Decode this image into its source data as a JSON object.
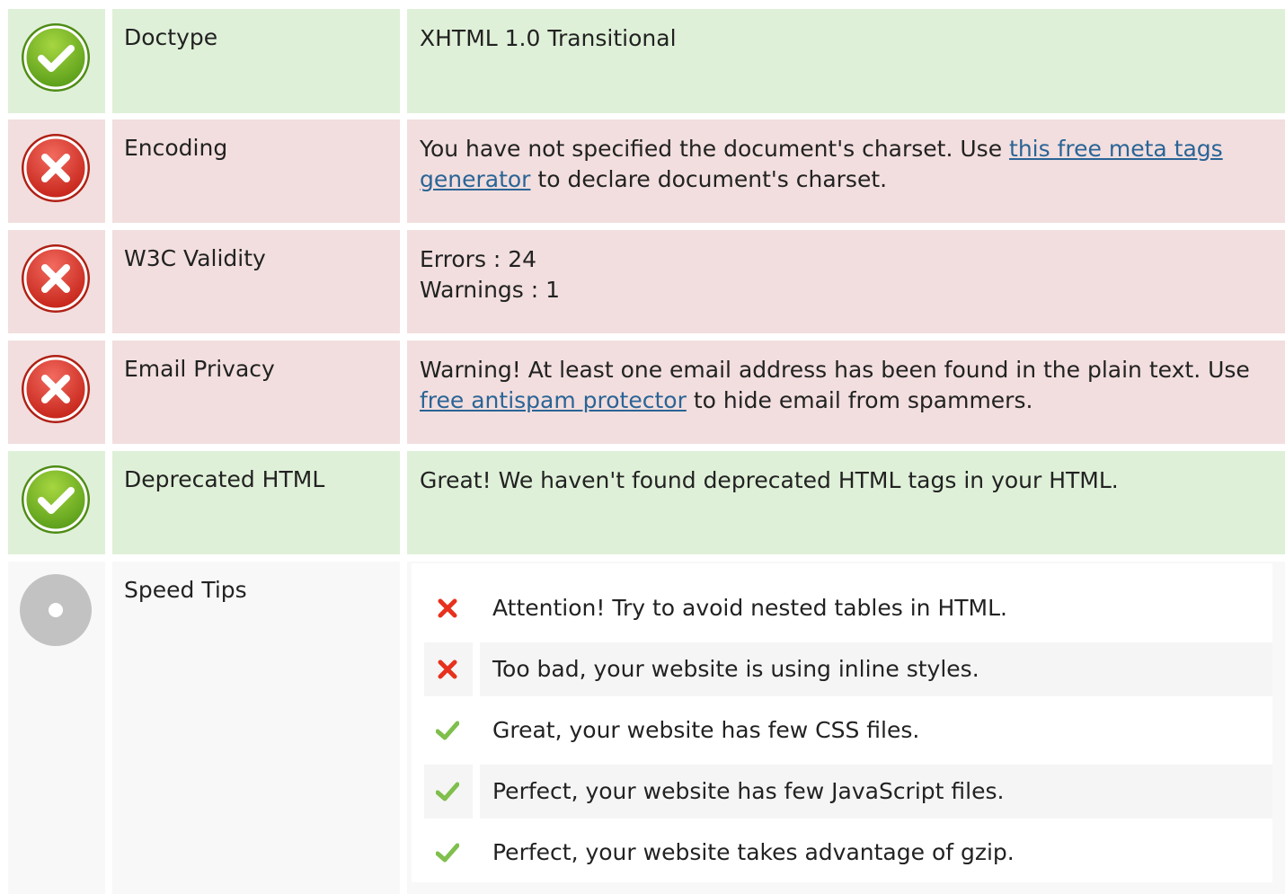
{
  "rows": [
    {
      "status": "ok",
      "label": "Doctype",
      "value": "XHTML 1.0 Transitional"
    },
    {
      "status": "error",
      "label": "Encoding",
      "value_before": "You have not specified the document's charset. Use ",
      "link_text": "this free meta tags generator",
      "value_after": " to declare document's charset."
    },
    {
      "status": "error",
      "label": "W3C Validity",
      "line1": "Errors : 24",
      "line2": "Warnings : 1"
    },
    {
      "status": "error",
      "label": "Email Privacy",
      "value_before": "Warning! At least one email address has been found in the plain text. Use ",
      "link_text": "free antispam protector",
      "value_after": " to hide email from spammers."
    },
    {
      "status": "ok",
      "label": "Deprecated HTML",
      "value": "Great! We haven't found deprecated HTML tags in your HTML."
    },
    {
      "status": "neutral",
      "label": "Speed Tips"
    }
  ],
  "speed_tips": [
    {
      "status": "fail",
      "icon": "cross-icon",
      "text": "Attention! Try to avoid nested tables in HTML."
    },
    {
      "status": "fail",
      "icon": "cross-icon",
      "text": "Too bad, your website is using inline styles."
    },
    {
      "status": "pass",
      "icon": "check-icon",
      "text": "Great, your website has few CSS files."
    },
    {
      "status": "pass",
      "icon": "check-icon",
      "text": "Perfect, your website has few JavaScript files."
    },
    {
      "status": "pass",
      "icon": "check-icon",
      "text": "Perfect, your website takes advantage of gzip."
    }
  ],
  "colors": {
    "ok_bg": "#dff0d8",
    "error_bg": "#f2dede",
    "neutral_bg": "#f8f8f8",
    "check_green": "#7fbf4d",
    "cross_red": "#e7311d",
    "link": "#2a6496"
  }
}
